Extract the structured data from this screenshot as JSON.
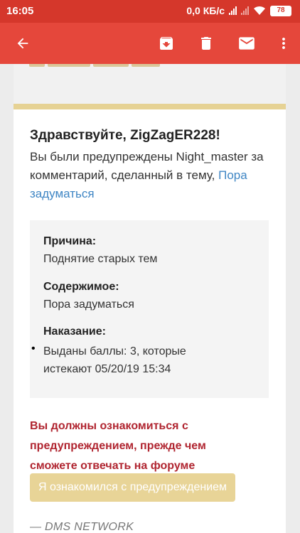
{
  "status_bar": {
    "time": "16:05",
    "network_speed": "0,0 КБ/с",
    "battery_level": "78"
  },
  "app_bar": {
    "icons": [
      "back-arrow-icon",
      "archive-icon",
      "delete-icon",
      "mail-icon",
      "more-vert-icon"
    ]
  },
  "email": {
    "greeting": "Здравствуйте, ZigZagER228!",
    "intro_text": "Вы были предупреждены Night_master за комментарий, сделанный в тему,",
    "intro_link": "Пора задуматься",
    "reason_label": "Причина:",
    "reason_value": "Поднятие старых тем",
    "content_label": "Содержимое:",
    "content_link": "Пора задуматься",
    "penalty_label": "Наказание:",
    "penalty_item": "Выданы баллы: 3, которые истекают 05/20/19 15:34",
    "warning": "Вы должны ознакомиться с предупреждением, прежде чем сможете отвечать на форуме",
    "ack_button": "Я ознакомился с предупреждением",
    "signoff": "— DMS NETWORK"
  },
  "colors": {
    "status_bar": "#d5372b",
    "app_bar": "#e5473b",
    "link": "#3f86c4",
    "warning": "#b02530",
    "gold": "#e6d294"
  }
}
